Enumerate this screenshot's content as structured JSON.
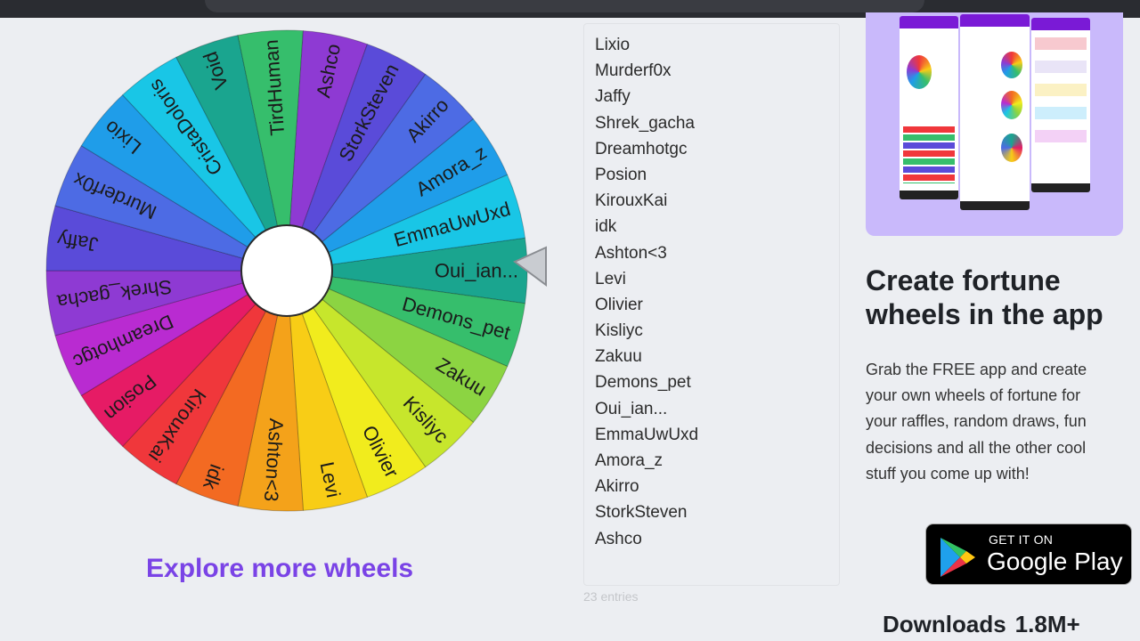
{
  "wheel": {
    "names": [
      "Oui_ian...",
      "Demons_pet",
      "Zakuu",
      "Kisliyc",
      "Olivier",
      "Levi",
      "Ashton<3",
      "idk",
      "KirouxKai",
      "Posion",
      "Dreamhotgc",
      "Shrek_gacha",
      "Jaffy",
      "Murderf0x",
      "Lixio",
      "CristaDoloris",
      "Void",
      "TirdHuman",
      "Ashco",
      "StorkSteven",
      "Akirro",
      "Amora_z",
      "EmmaUwUxd"
    ],
    "colors": [
      "#1aa58f",
      "#36be6c",
      "#8cd442",
      "#c7e62c",
      "#f1ec1d",
      "#f8cd16",
      "#f4a21a",
      "#f36a22",
      "#f0373b",
      "#e61b65",
      "#b92bd1",
      "#8e3ad3",
      "#5a4bd9",
      "#4d6be4",
      "#1f9de9",
      "#19c6e6",
      "#1aa58f",
      "#36be6c",
      "#8e3ad3",
      "#5a4bd9",
      "#4d6be4",
      "#1f9de9",
      "#19c6e6"
    ]
  },
  "explore_label": "Explore more wheels",
  "entries": {
    "items": [
      "Lixio",
      "Murderf0x",
      "Jaffy",
      "Shrek_gacha",
      "Dreamhotgc",
      "Posion",
      "KirouxKai",
      "idk",
      "Ashton<3",
      "Levi",
      "Olivier",
      "Kisliyc",
      "Zakuu",
      "Demons_pet",
      "Oui_ian...",
      "EmmaUwUxd",
      "Amora_z",
      "Akirro",
      "StorkSteven",
      "Ashco"
    ],
    "count_label": "23 entries"
  },
  "promo": {
    "title": "Create fortune wheels in the app",
    "text": "Grab the FREE app and create your own wheels of fortune for your raffles, random draws, fun decisions and all the other cool stuff you come up with!",
    "badge_line1": "GET IT ON",
    "badge_line2": "Google Play",
    "downloads_label": "Downloads",
    "downloads_value": "1.8M+"
  },
  "icons": {
    "pointer": "wheel-pointer-icon",
    "play": "google-play-icon"
  }
}
